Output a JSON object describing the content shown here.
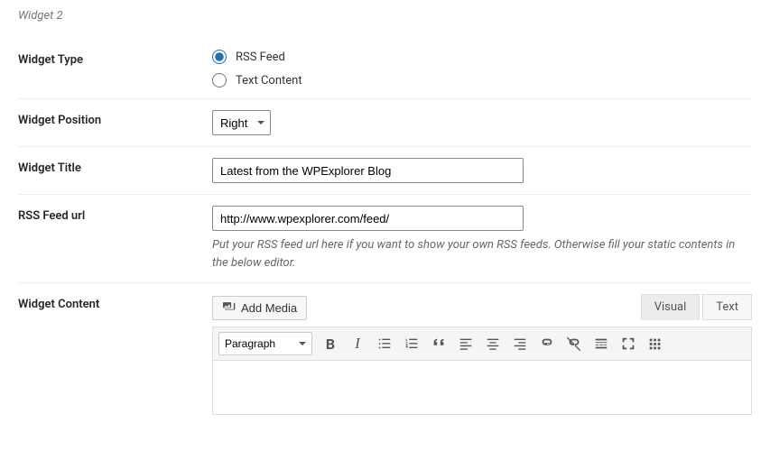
{
  "section_title": "Widget 2",
  "rows": {
    "widget_type": {
      "label": "Widget Type",
      "options": [
        {
          "label": "RSS Feed",
          "checked": true
        },
        {
          "label": "Text Content",
          "checked": false
        }
      ]
    },
    "widget_position": {
      "label": "Widget Position",
      "value": "Right"
    },
    "widget_title": {
      "label": "Widget Title",
      "value": "Latest from the WPExplorer Blog"
    },
    "rss_feed_url": {
      "label": "RSS Feed url",
      "value": "http://www.wpexplorer.com/feed/",
      "desc": "Put your RSS feed url here if you want to show your own RSS feeds. Otherwise fill your static contents in the below editor."
    },
    "widget_content": {
      "label": "Widget Content",
      "add_media": "Add Media",
      "tabs": {
        "visual": "Visual",
        "text": "Text"
      },
      "format_select": "Paragraph"
    }
  }
}
